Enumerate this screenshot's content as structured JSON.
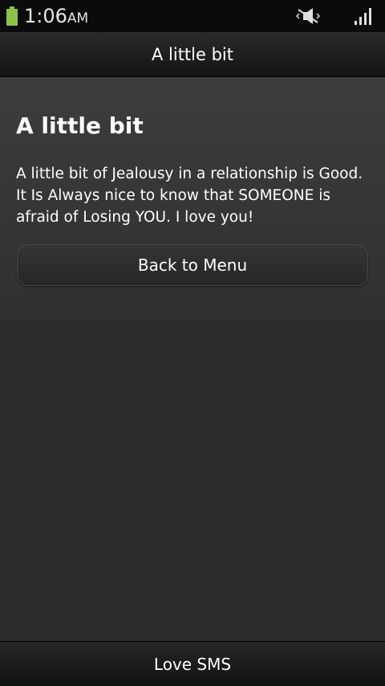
{
  "status_bar": {
    "time": "1:06",
    "ampm": "AM",
    "icons": [
      "battery-icon",
      "mute-icon",
      "signal-icon"
    ],
    "battery_color": "#8bc34a"
  },
  "title_bar": {
    "title": "A little bit"
  },
  "content": {
    "heading": "A little bit",
    "message": "A little bit of Jealousy in a relationship is Good. It Is Always nice to know that SOMEONE is afraid of Losing YOU. I love you!",
    "back_button_label": "Back to Menu"
  },
  "bottom_bar": {
    "label": "Love SMS"
  }
}
